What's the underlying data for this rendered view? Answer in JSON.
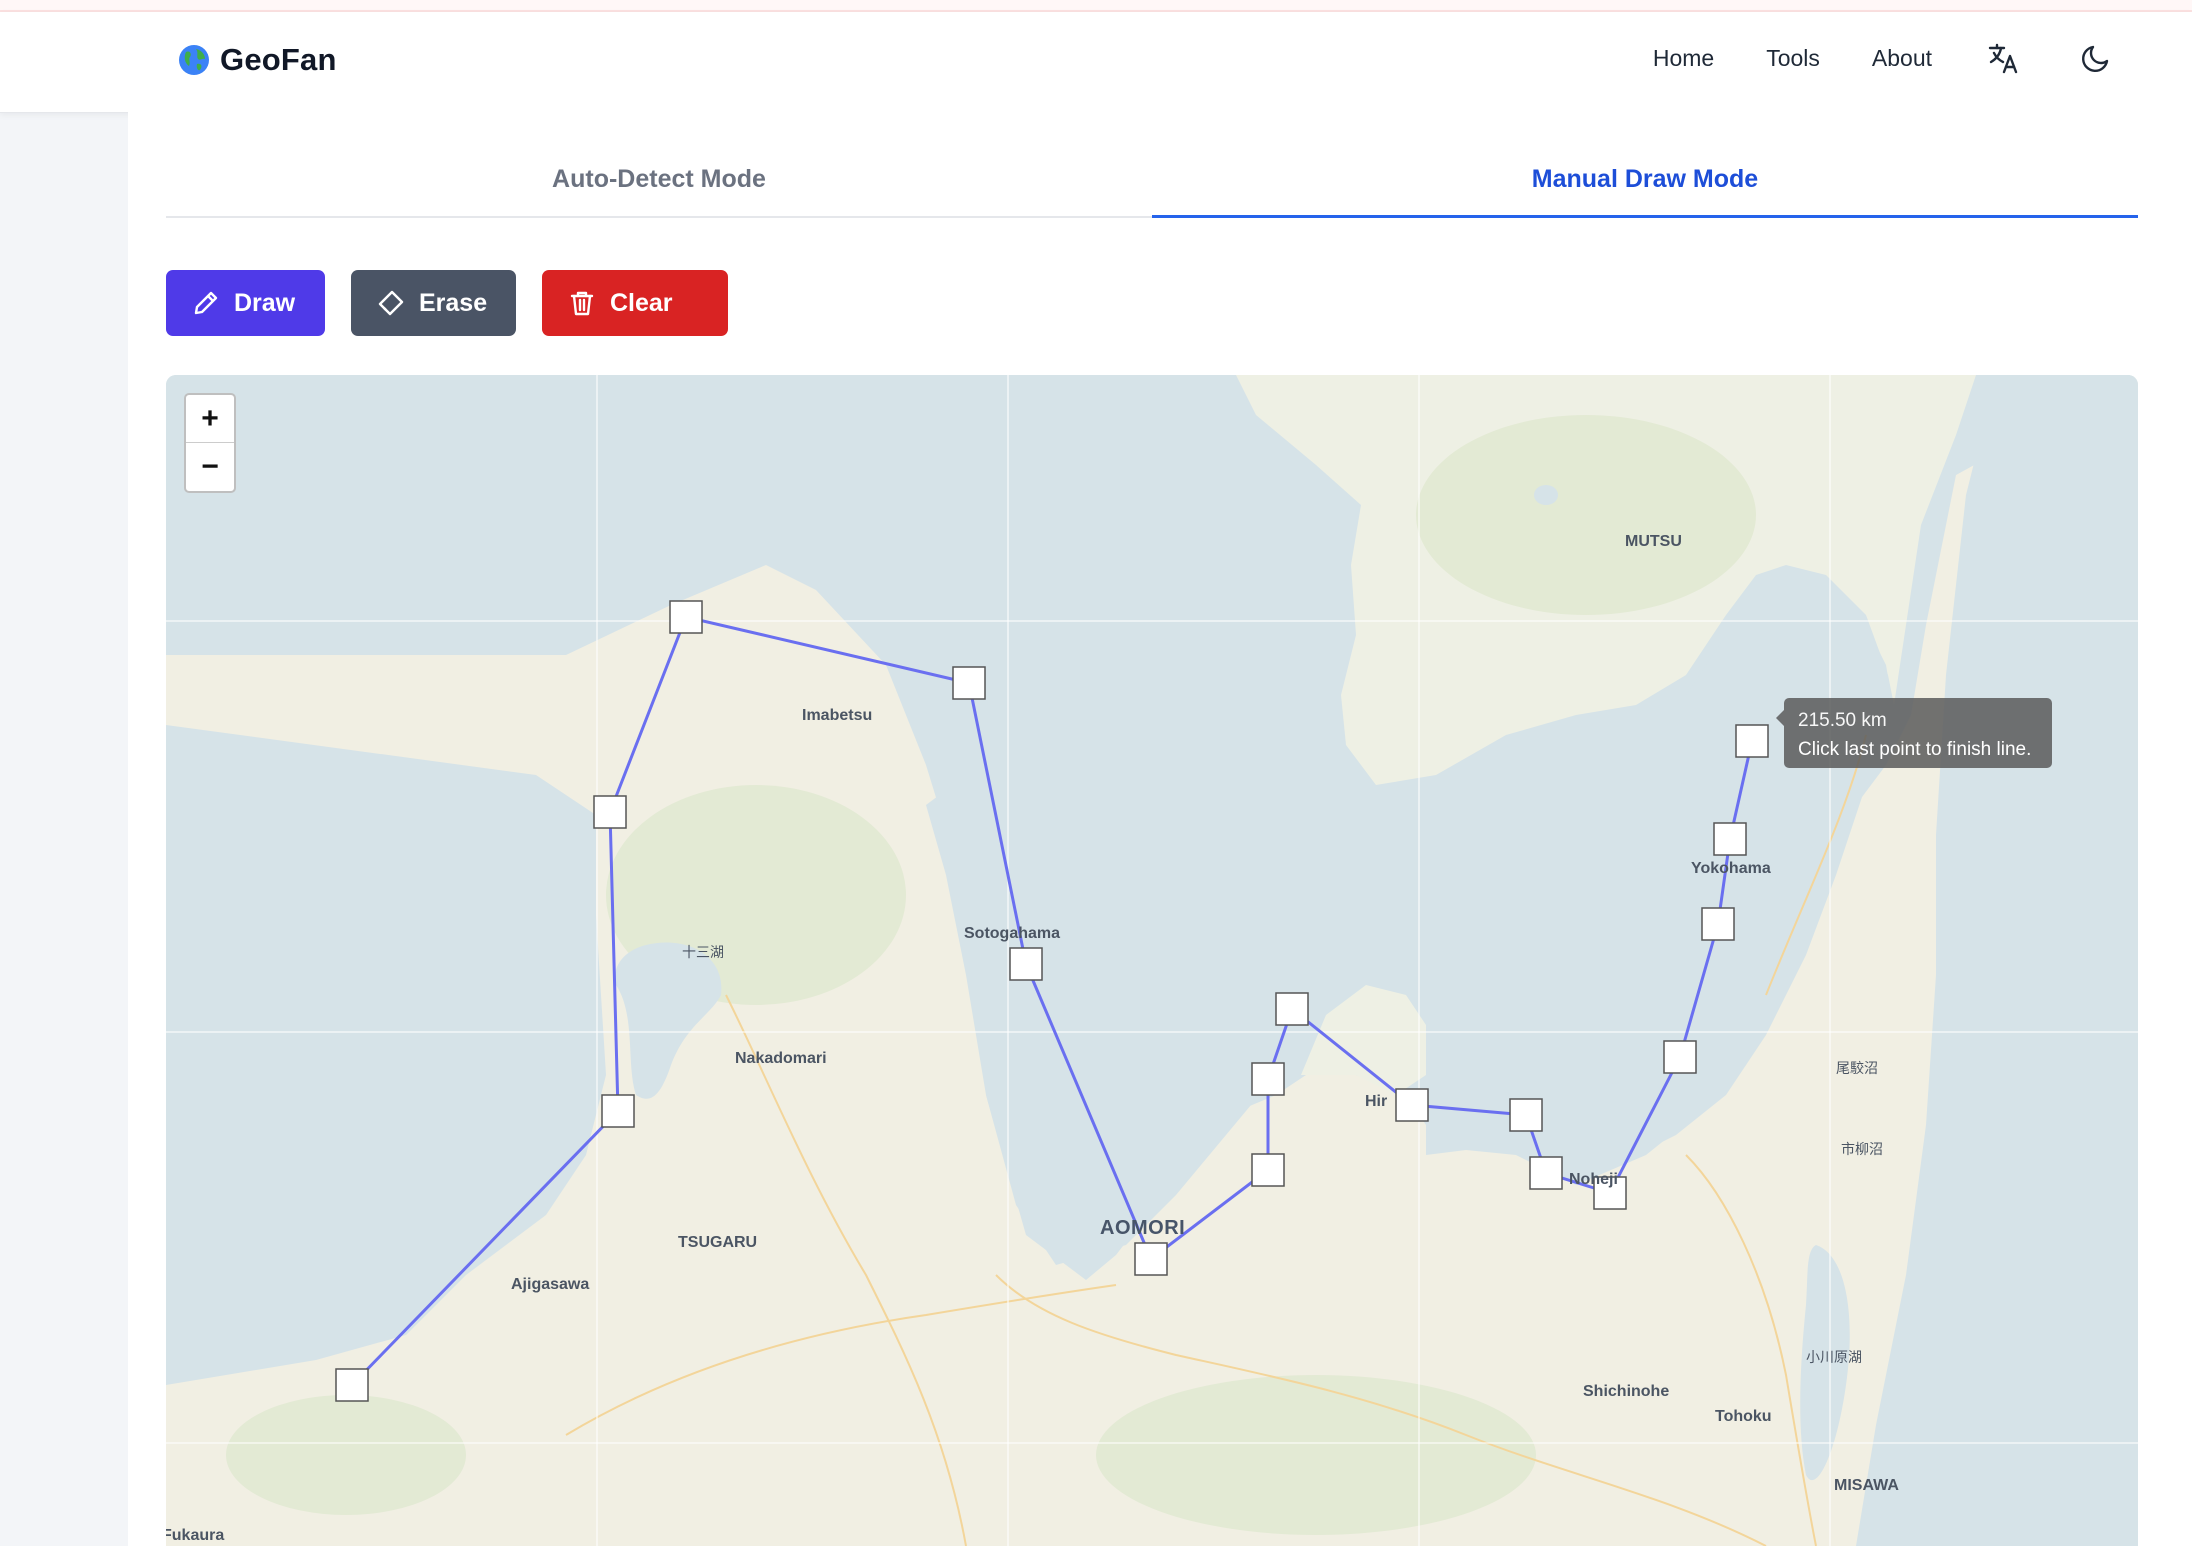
{
  "app": {
    "name": "GeoFan"
  },
  "nav": {
    "home": "Home",
    "tools": "Tools",
    "about": "About"
  },
  "tabs": {
    "auto": "Auto-Detect Mode",
    "manual": "Manual Draw Mode"
  },
  "toolbar": {
    "draw": "Draw",
    "erase": "Erase",
    "clear": "Clear"
  },
  "map": {
    "zoom_in": "+",
    "zoom_out": "−",
    "tooltip": {
      "distance": "215.50 km",
      "hint": "Click last point to finish line."
    },
    "labels": {
      "mutsu": "MUTSU",
      "imabetsu": "Imabetsu",
      "yokohama": "Yokohama",
      "sotogahama": "Sotogahama",
      "jusanko": "十三湖",
      "nakadomari": "Nakadomari",
      "obuchinuma": "尾駮沼",
      "ichiyanagi": "市柳沼",
      "hiranai": "Hir",
      "noheji": "Noheji",
      "aomori": "AOMORI",
      "tsugaru": "TSUGARU",
      "ajigasawa": "Ajigasawa",
      "ogawara": "小川原湖",
      "shichinohe": "Shichinohe",
      "tohoku": "Tohoku",
      "misawa": "MISAWA",
      "fukaura": "Fukaura"
    }
  },
  "colors": {
    "primary_blue": "#2563eb",
    "draw_button": "#4f3ae8",
    "erase_button": "#4a5465",
    "clear_button": "#d92323",
    "route_line": "#6a6ff0"
  }
}
